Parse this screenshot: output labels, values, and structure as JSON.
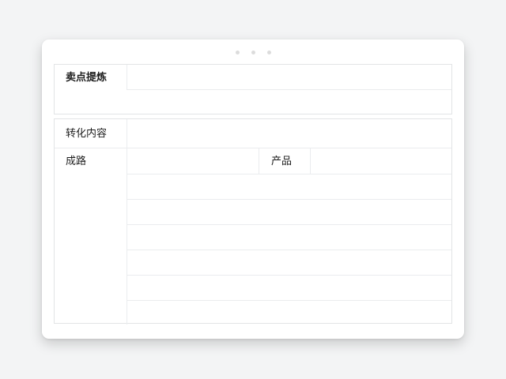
{
  "header_dots": [
    "dot",
    "dot",
    "dot"
  ],
  "section1": {
    "label": "卖点提炼"
  },
  "section2": {
    "label": "转化内容",
    "row_left_label": "成路",
    "row_mid_label": "产品"
  }
}
